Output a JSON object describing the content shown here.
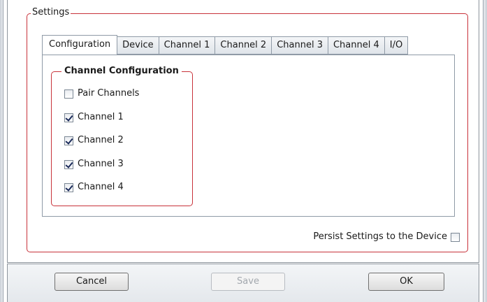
{
  "settings": {
    "group_title": "Settings",
    "tabs": [
      {
        "label": "Configuration",
        "selected": true
      },
      {
        "label": "Device",
        "selected": false
      },
      {
        "label": "Channel 1",
        "selected": false
      },
      {
        "label": "Channel 2",
        "selected": false
      },
      {
        "label": "Channel 3",
        "selected": false
      },
      {
        "label": "Channel 4",
        "selected": false
      },
      {
        "label": "I/O",
        "selected": false
      }
    ],
    "channel_configuration": {
      "title": "Channel Configuration",
      "options": [
        {
          "label": "Pair Channels",
          "checked": false
        },
        {
          "label": "Channel 1",
          "checked": true
        },
        {
          "label": "Channel 2",
          "checked": true
        },
        {
          "label": "Channel 3",
          "checked": true
        },
        {
          "label": "Channel 4",
          "checked": true
        }
      ]
    },
    "persist": {
      "label": "Persist Settings to the Device",
      "checked": false
    }
  },
  "buttons": {
    "cancel": {
      "label": "Cancel",
      "enabled": true
    },
    "save": {
      "label": "Save",
      "enabled": false
    },
    "ok": {
      "label": "OK",
      "enabled": true
    }
  },
  "colors": {
    "group_border": "#c8323a",
    "tab_border": "#8f9aa6",
    "disabled_text": "#a3a8ae"
  }
}
